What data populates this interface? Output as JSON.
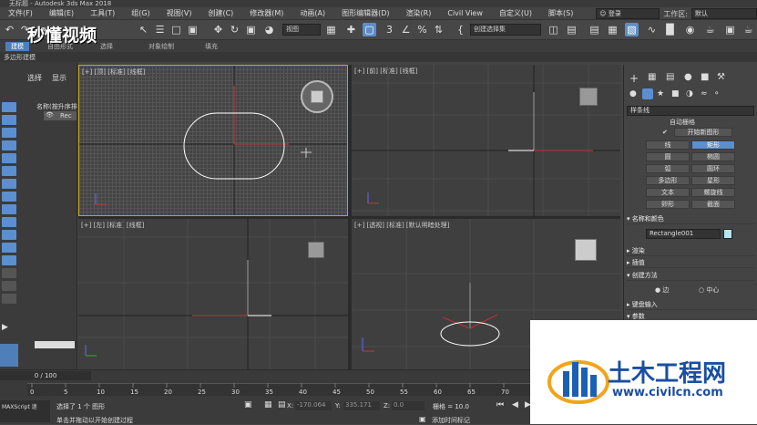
{
  "window": {
    "title": "无标题 - Autodesk 3ds Max 2018"
  },
  "menu": {
    "items": [
      "文件(F)",
      "编辑(E)",
      "工具(T)",
      "组(G)",
      "视图(V)",
      "创建(C)",
      "修改器(M)",
      "动画(A)",
      "图形编辑器(D)",
      "渲染(R)",
      "Civil View",
      "自定义(U)",
      "脚本(S)"
    ],
    "signin_label": "登录",
    "workspace_label": "工作区:",
    "workspace_value": "默认"
  },
  "toolbar": {
    "view_dropdown": "视图",
    "selection_set_dropdown": "创建选择集"
  },
  "ribbon": {
    "tabs": [
      "建模",
      "自由形式",
      "选择",
      "对象绘制",
      "填充"
    ]
  },
  "ribbon_sub": {
    "label": "多边形建模"
  },
  "scene_explorer": {
    "tabs": [
      "选择",
      "显示"
    ],
    "column_header": "名称(按升序排",
    "row_label": "Rec"
  },
  "viewports": [
    {
      "label": "[+] [顶] [标准] [线框]",
      "active": true
    },
    {
      "label": "[+] [前] [标准] [线框]",
      "active": false
    },
    {
      "label": "[+] [左] [标准] [线框]",
      "active": false
    },
    {
      "label": "[+] [透视] [标准] [默认明暗处理]",
      "active": false
    }
  ],
  "command_panel": {
    "category_dropdown": "样条线",
    "auto_grid": "自动栅格",
    "start_new_shape": "开始新图形",
    "object_types": [
      "线",
      "矩形",
      "圆",
      "椭圆",
      "弧",
      "圆环",
      "多边形",
      "星形",
      "文本",
      "螺旋线",
      "卵形",
      "截面"
    ],
    "selected_type": "矩形",
    "name_color_title": "名称和颜色",
    "object_name": "Rectangle001",
    "object_color": "#b4e6f0",
    "rollouts": [
      "渲染",
      "插值",
      "创建方法"
    ],
    "creation_methods": [
      "边",
      "中心"
    ],
    "rollouts_after": [
      "键盘输入",
      "参数"
    ]
  },
  "timeline": {
    "frame_counter": "0 / 100",
    "ticks": [
      "0",
      "5",
      "10",
      "15",
      "20",
      "25",
      "30",
      "35",
      "40",
      "45",
      "50",
      "55",
      "60",
      "65",
      "70"
    ]
  },
  "status": {
    "maxscript": "MAXScript 迷",
    "selected": "选择了 1 个 图形",
    "prompt": "单击并拖动以开始创建过程",
    "x_label": "X:",
    "x_value": "-170.064",
    "y_label": "Y:",
    "y_value": "335.171",
    "z_label": "Z:",
    "z_value": "0.0",
    "grid_label": "栅格 = 10.0",
    "add_time_tag": "添加时间标记"
  },
  "watermark": {
    "brand_top": "秒懂视频",
    "brand_cn": "土木工程网",
    "brand_url": "www.civilcn.com"
  }
}
